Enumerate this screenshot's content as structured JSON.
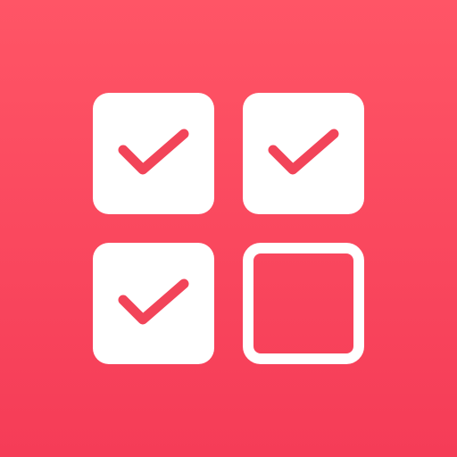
{
  "icon": {
    "background_top": "#ff5566",
    "background_bottom": "#f53c57",
    "foreground": "#ffffff",
    "check_color": "#f24459"
  },
  "checkboxes": [
    {
      "state": "checked",
      "icon": "checkmark-icon"
    },
    {
      "state": "checked",
      "icon": "checkmark-icon"
    },
    {
      "state": "checked",
      "icon": "checkmark-icon"
    },
    {
      "state": "unchecked",
      "icon": "empty-box"
    }
  ]
}
